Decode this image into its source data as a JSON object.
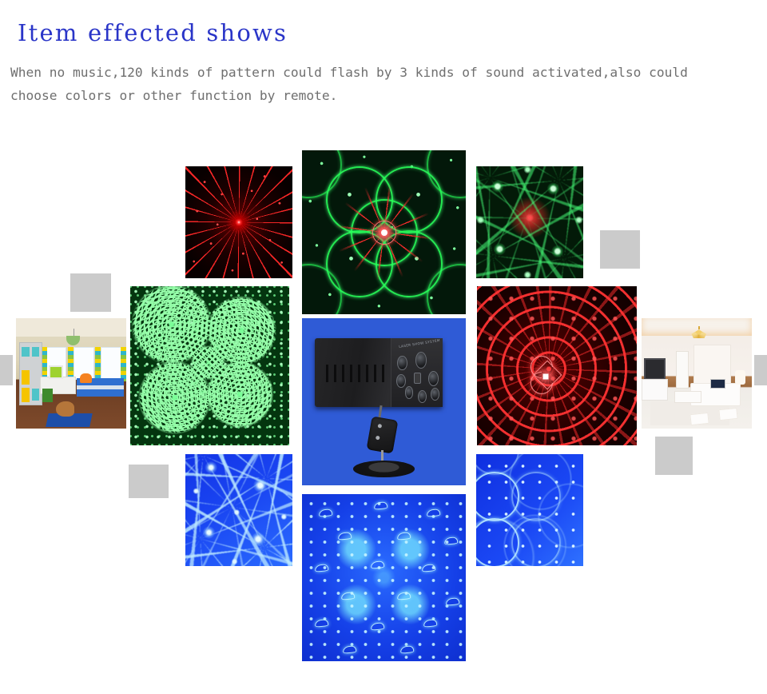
{
  "page": {
    "title": "Item effected shows",
    "title_color": "#2a35c8",
    "description_line_1": "When no music,120 kinds of pattern could flash by 3 kinds of sound activated,also could",
    "description_line_2": "choose colors or other function by remote.",
    "description_color": "#6f6f6f",
    "background_color": "#ffffff"
  },
  "device": {
    "label": "LASER SHOW SYSTEM",
    "background_color": "#2f5bd6",
    "body_color": "#1d1d1f"
  },
  "tiles": [
    {
      "name": "red-starburst-pattern",
      "caption": "Red radial starburst laser pattern",
      "primary_color": "#ff2a2a"
    },
    {
      "name": "green-flower-red-burst-pattern",
      "caption": "Green interlocking circles with red starburst center",
      "primary_color": "#28ff5a"
    },
    {
      "name": "green-swirl-red-core-pattern",
      "caption": "Green swirl grid with red glowing core",
      "primary_color": "#46ff78"
    },
    {
      "name": "green-dotted-spiral-pattern",
      "caption": "Green dotted spiral galaxy pattern",
      "primary_color": "#78ff96"
    },
    {
      "name": "laser-projector-product-photo",
      "caption": "Black laser show projector on blue background",
      "primary_color": "#2f5bd6"
    },
    {
      "name": "red-heart-spiral-pattern",
      "caption": "Red spiral of star dots with heart outline center",
      "primary_color": "#ff3232"
    },
    {
      "name": "blue-swirl-pattern",
      "caption": "Blue swirling laser pattern",
      "primary_color": "#1a46f2"
    },
    {
      "name": "blue-dolphin-grid-pattern",
      "caption": "Blue grid of dolphin shapes with dot field",
      "primary_color": "#2a6bff"
    },
    {
      "name": "blue-circles-pattern",
      "caption": "Blue interlocking circles laser pattern",
      "primary_color": "#1b49f5"
    },
    {
      "name": "kids-bedroom-photo",
      "caption": "Colorful children's bedroom interior",
      "primary_color": "#2fb6c9"
    },
    {
      "name": "white-bedroom-photo",
      "caption": "White bedroom interior with chandelier",
      "primary_color": "#f3ece6"
    }
  ],
  "placeholders": {
    "count": 6,
    "color": "#cbcbcb",
    "caption": "Broken image placeholder"
  }
}
